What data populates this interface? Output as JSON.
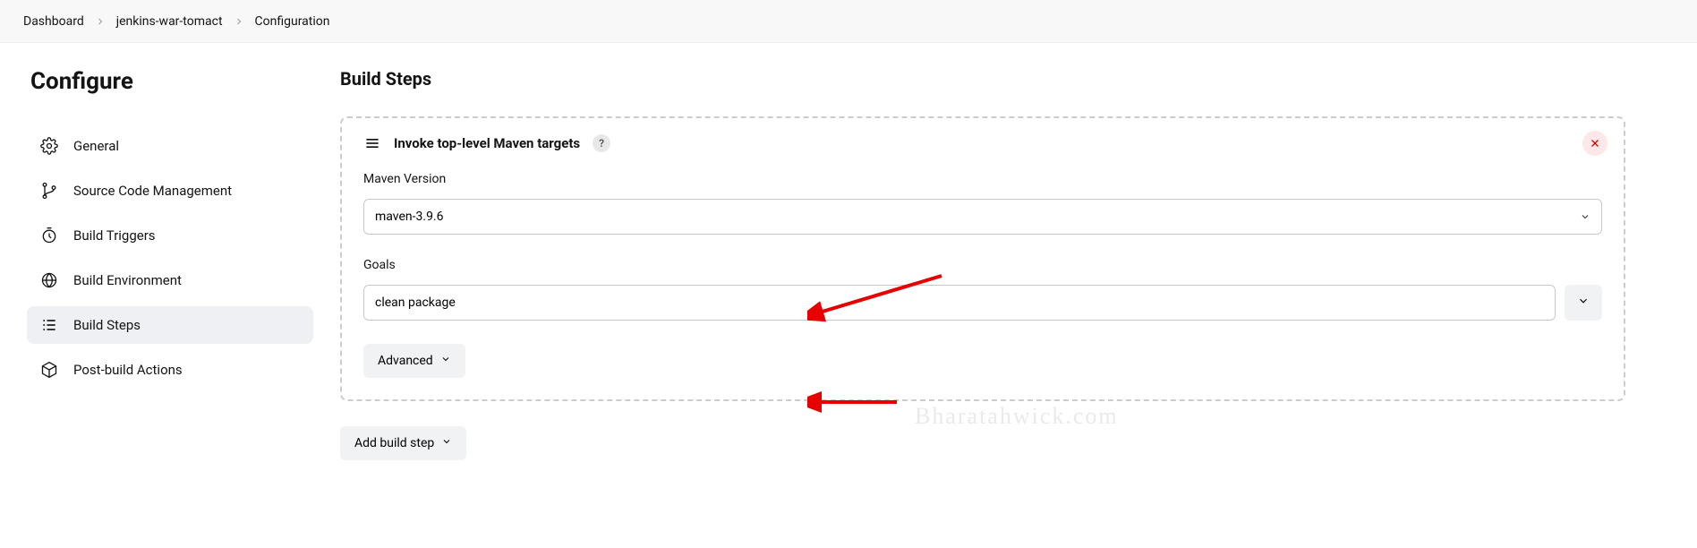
{
  "breadcrumbs": {
    "items": [
      "Dashboard",
      "jenkins-war-tomact",
      "Configuration"
    ]
  },
  "page": {
    "title": "Configure",
    "section_title": "Build Steps"
  },
  "sidenav": {
    "items": [
      {
        "label": "General"
      },
      {
        "label": "Source Code Management"
      },
      {
        "label": "Build Triggers"
      },
      {
        "label": "Build Environment"
      },
      {
        "label": "Build Steps"
      },
      {
        "label": "Post-build Actions"
      }
    ]
  },
  "build_step": {
    "title": "Invoke top-level Maven targets",
    "help_label": "?",
    "maven_version_label": "Maven Version",
    "maven_version_value": "maven-3.9.6",
    "goals_label": "Goals",
    "goals_value": "clean package",
    "advanced_label": "Advanced"
  },
  "actions": {
    "add_step_label": "Add build step"
  },
  "watermark": "Bharatahwick.com"
}
